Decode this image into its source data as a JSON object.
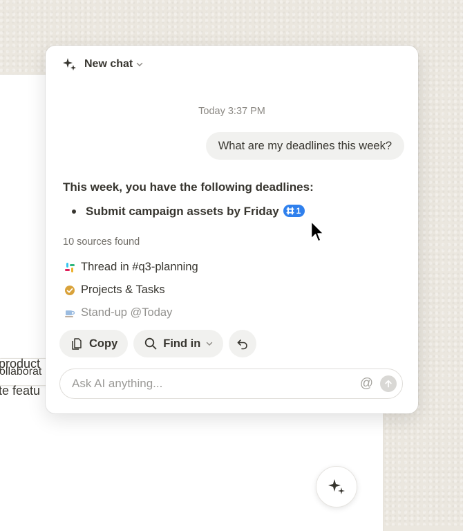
{
  "background_page": {
    "chip_text": "ollaborat",
    "lines": [
      "product",
      "te featu"
    ]
  },
  "chat": {
    "title": "New chat",
    "timestamp": "Today 3:37 PM",
    "user_message": "What are my deadlines this week?",
    "assistant": {
      "intro": "This week, you have the following deadlines:",
      "bullets": [
        {
          "text": "Submit campaign assets by Friday",
          "citation_count": "1",
          "citation_icon": "slack-icon"
        }
      ]
    },
    "sources": {
      "summary": "10 sources found",
      "items": [
        {
          "icon": "slack-icon",
          "label": "Thread in #q3-planning"
        },
        {
          "icon": "check-circle-icon",
          "label": "Projects & Tasks"
        },
        {
          "icon": "coffee-icon",
          "label": "Stand-up @Today"
        }
      ]
    },
    "actions": {
      "copy_label": "Copy",
      "find_label": "Find in"
    },
    "input": {
      "placeholder": "Ask AI anything...",
      "value": "",
      "mention_symbol": "@"
    }
  },
  "colors": {
    "accent_blue": "#2f80ed",
    "text": "#37352f",
    "muted": "#8b8883",
    "bubble": "#f1f1ef",
    "background": "#ebe7df"
  }
}
